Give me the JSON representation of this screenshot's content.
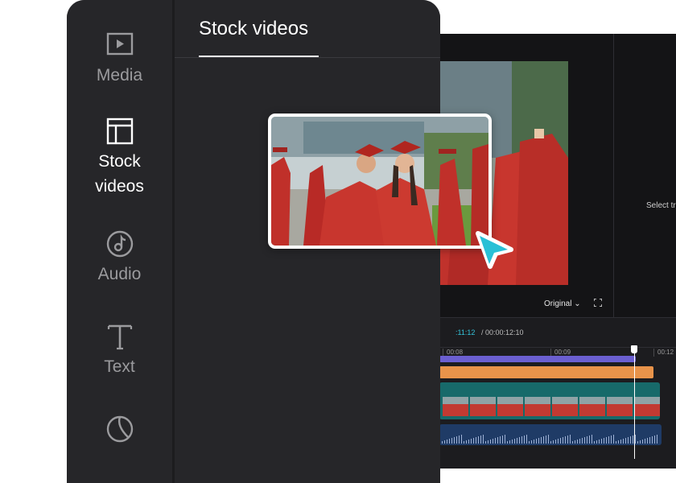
{
  "sidebar": {
    "items": [
      {
        "label": "Media",
        "icon": "media-icon"
      },
      {
        "label": "Stock\nvideos",
        "icon": "stock-videos-icon",
        "active": true
      },
      {
        "label": "Audio",
        "icon": "audio-icon"
      },
      {
        "label": "Text",
        "icon": "text-icon"
      },
      {
        "label": "",
        "icon": "stickers-icon"
      }
    ]
  },
  "panel": {
    "tab_title": "Stock videos"
  },
  "player": {
    "aspect_label": "Original",
    "select_hint": "Select tr",
    "current_time": ":11:12",
    "total_time": "/ 00:00:12:10"
  },
  "timeline": {
    "ruler_labels": [
      "00:08",
      "00:09",
      "00:12"
    ]
  },
  "colors": {
    "accent": "#33c3d9",
    "panel_bg": "#262629",
    "editor_bg": "#1c1c1f",
    "track_purple": "#6b5fd0",
    "track_orange": "#e8934a",
    "track_video": "#176a6a",
    "track_audio": "#1f3b66"
  }
}
